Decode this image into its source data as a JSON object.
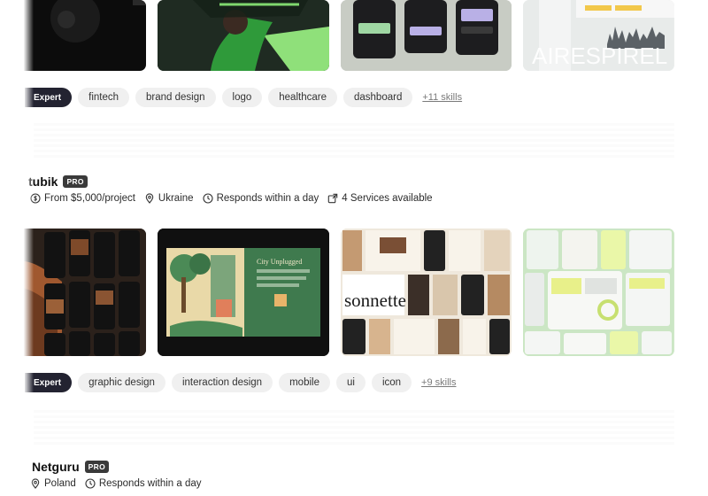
{
  "rows": [
    {
      "tags": {
        "level": "Expert",
        "skills": [
          "fintech",
          "brand design",
          "logo",
          "healthcare",
          "dashboard"
        ],
        "more": "+11 skills"
      }
    },
    {
      "agency": {
        "name": "tubik",
        "badge": "PRO"
      },
      "meta": {
        "price": "From $5,000/project",
        "location": "Ukraine",
        "response": "Responds within a day",
        "services": "4 Services available"
      },
      "thumb_texts": [
        "City Unplugged",
        "sonnette"
      ],
      "tags": {
        "level": "Expert",
        "skills": [
          "graphic design",
          "interaction design",
          "mobile",
          "ui",
          "icon"
        ],
        "more": "+9 skills"
      }
    },
    {
      "agency": {
        "name": "Netguru",
        "badge": "PRO"
      },
      "meta": {
        "location": "Poland",
        "response": "Responds within a day"
      }
    }
  ],
  "thumb_watermark": "AIRESPIREL",
  "colors": {
    "expert_badge": "#232331",
    "tag_bg": "#f0f0f0",
    "pro_badge": "#3a3a3a",
    "accent_green": "#8fe07a"
  }
}
